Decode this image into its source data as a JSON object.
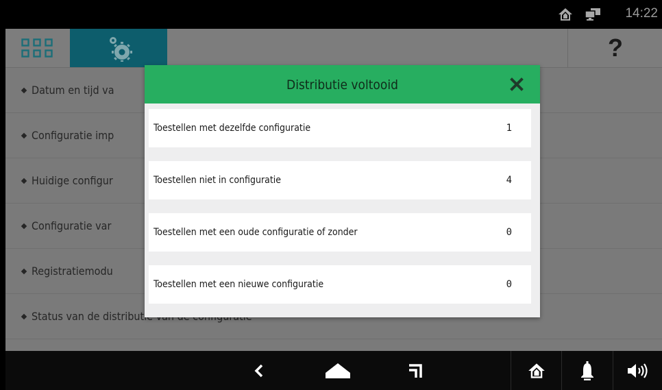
{
  "status_bar": {
    "time": "14:22",
    "icons": [
      "home-icon",
      "network-icon"
    ]
  },
  "app_header": {
    "tabs": [
      "grid-apps-icon",
      "settings-gears-icon"
    ],
    "help_label": "?"
  },
  "menu": {
    "items": [
      {
        "label": "Datum en tijd va"
      },
      {
        "label": "Configuratie imp"
      },
      {
        "label": "Huidige configur"
      },
      {
        "label": "Configuratie var"
      },
      {
        "label": "Registratiemodu"
      },
      {
        "label": "Status van de distributie van de configuratie"
      }
    ]
  },
  "dialog": {
    "title": "Distributie voltooid",
    "close_icon": "close-icon",
    "rows": [
      {
        "label": "Toestellen met dezelfde configuratie",
        "value": "1"
      },
      {
        "label": "Toestellen niet in configuratie",
        "value": "4"
      },
      {
        "label": "Toestellen met een oude configuratie of zonder",
        "value": "0"
      },
      {
        "label": "Toestellen met een nieuwe configuratie",
        "value": "0"
      }
    ]
  },
  "nav_bar": {
    "icons": [
      "back-icon",
      "home-nav-icon",
      "recents-icon",
      "home-app-icon",
      "bell-icon",
      "volume-icon"
    ]
  },
  "colors": {
    "dialog_header": "#27ae60",
    "selected_tab": "#0d5d6c",
    "overlay_background": "#7a7a7a"
  }
}
